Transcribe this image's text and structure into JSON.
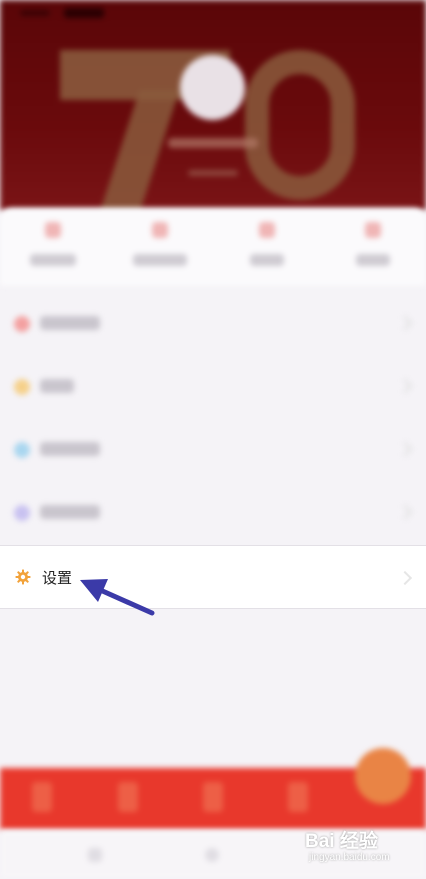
{
  "settings": {
    "label": "设置"
  },
  "watermark": {
    "brand": "Bai 经验",
    "url": "jingyan.baidu.com"
  },
  "colors": {
    "header_bg": "#5a0608",
    "bottom_bar": "#e8382c",
    "arrow": "#3b3aa8",
    "gear": "#f2a23a"
  },
  "icons": {
    "settings": "gear-icon",
    "annotation": "arrow-annotation"
  }
}
